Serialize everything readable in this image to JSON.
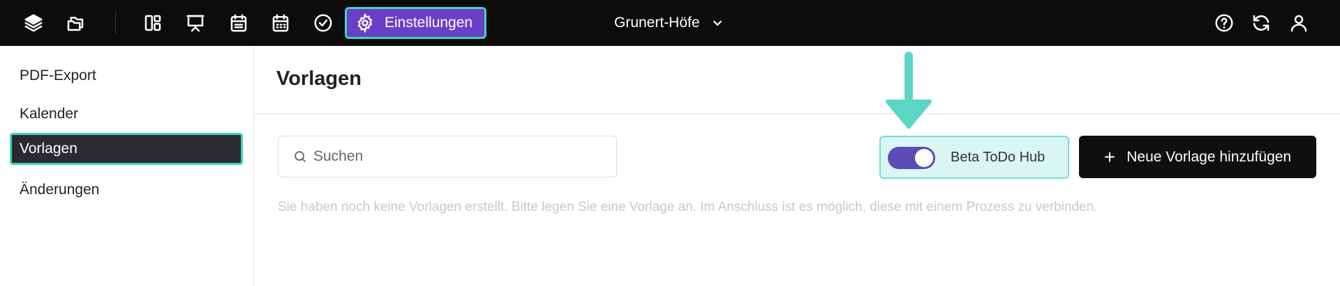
{
  "topbar": {
    "icons": [
      "layers-icon",
      "folders-icon",
      "dashboard-icon",
      "presentation-icon",
      "calendar-list-icon",
      "calendar-icon",
      "check-circle-icon"
    ],
    "settings_label": "Einstellungen",
    "project_name": "Grunert-Höfe",
    "right_icons": [
      "help-icon",
      "refresh-icon",
      "user-icon"
    ]
  },
  "sidebar": {
    "items": [
      {
        "label": "PDF-Export",
        "active": false
      },
      {
        "label": "Kalender",
        "active": false
      },
      {
        "label": "Vorlagen",
        "active": true
      },
      {
        "label": "Änderungen",
        "active": false
      }
    ]
  },
  "main": {
    "title": "Vorlagen",
    "search_placeholder": "Suchen",
    "beta_label": "Beta ToDo Hub",
    "beta_enabled": true,
    "add_button_label": "Neue Vorlage hinzufügen",
    "empty_message": "Sie haben noch keine Vorlagen erstellt. Bitte legen Sie eine Vorlage an. Im Anschluss ist es möglich, diese mit einem Prozess zu verbinden."
  },
  "colors": {
    "topbar": "#0c0c0c",
    "accent": "#6a3fc8",
    "highlight": "#3fd3c0",
    "toggle": "#5c4cb8",
    "beta_bg": "#d9f6f2"
  }
}
